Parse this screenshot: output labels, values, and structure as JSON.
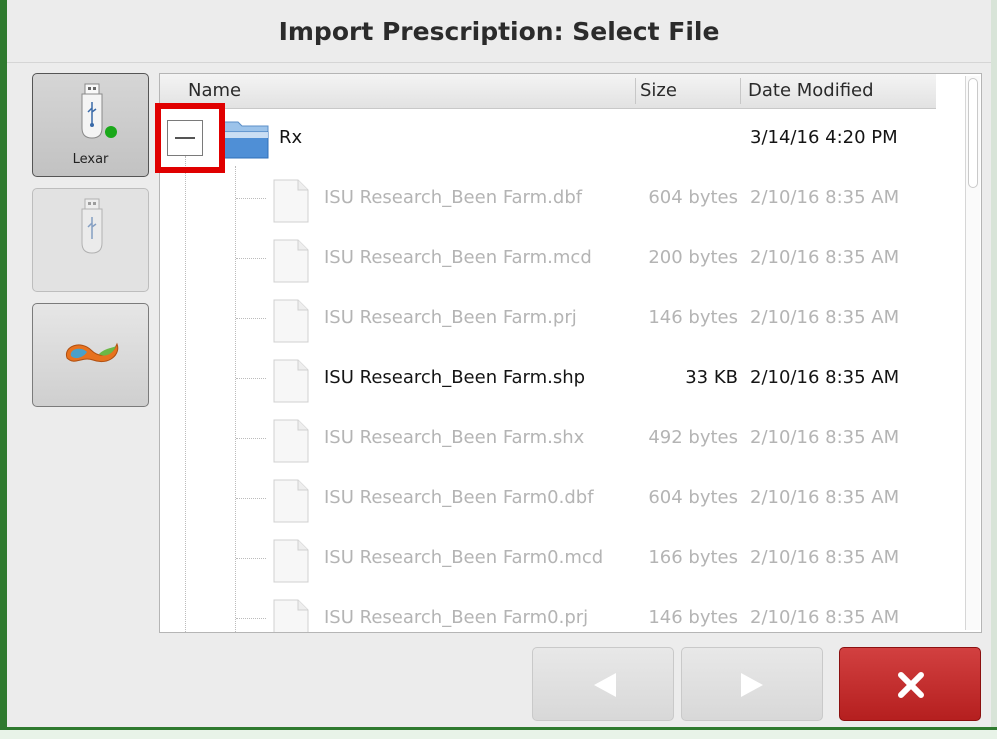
{
  "dialog": {
    "title": "Import Prescription: Select File"
  },
  "devices": [
    {
      "label": "Lexar",
      "icon": "usb-drive-icon",
      "state": "selected"
    },
    {
      "label": "",
      "icon": "usb-drive-icon",
      "state": "disabled"
    },
    {
      "label": "",
      "icon": "cloud-service-icon",
      "state": "normal"
    }
  ],
  "columns": {
    "name": "Name",
    "size": "Size",
    "date": "Date Modified"
  },
  "folder": {
    "name": "Rx",
    "date": "3/14/16 4:20 PM",
    "expanded": true
  },
  "files": [
    {
      "name": "ISU Research_Been Farm.dbf",
      "size": "604 bytes",
      "date": "2/10/16 8:35 AM",
      "enabled": false
    },
    {
      "name": "ISU Research_Been Farm.mcd",
      "size": "200 bytes",
      "date": "2/10/16 8:35 AM",
      "enabled": false
    },
    {
      "name": "ISU Research_Been Farm.prj",
      "size": "146 bytes",
      "date": "2/10/16 8:35 AM",
      "enabled": false
    },
    {
      "name": "ISU Research_Been Farm.shp",
      "size": "33 KB",
      "date": "2/10/16 8:35 AM",
      "enabled": true
    },
    {
      "name": "ISU Research_Been Farm.shx",
      "size": "492 bytes",
      "date": "2/10/16 8:35 AM",
      "enabled": false
    },
    {
      "name": "ISU Research_Been Farm0.dbf",
      "size": "604 bytes",
      "date": "2/10/16 8:35 AM",
      "enabled": false
    },
    {
      "name": "ISU Research_Been Farm0.mcd",
      "size": "166 bytes",
      "date": "2/10/16 8:35 AM",
      "enabled": false
    },
    {
      "name": "ISU Research_Been Farm0.prj",
      "size": "146 bytes",
      "date": "2/10/16 8:35 AM",
      "enabled": false
    }
  ],
  "buttons": {
    "back": "left-arrow-icon",
    "forward": "right-arrow-icon",
    "close": "close-icon"
  },
  "colors": {
    "frame": "#2f7a2f",
    "highlight": "#e00000",
    "close": "#c02a2a"
  }
}
